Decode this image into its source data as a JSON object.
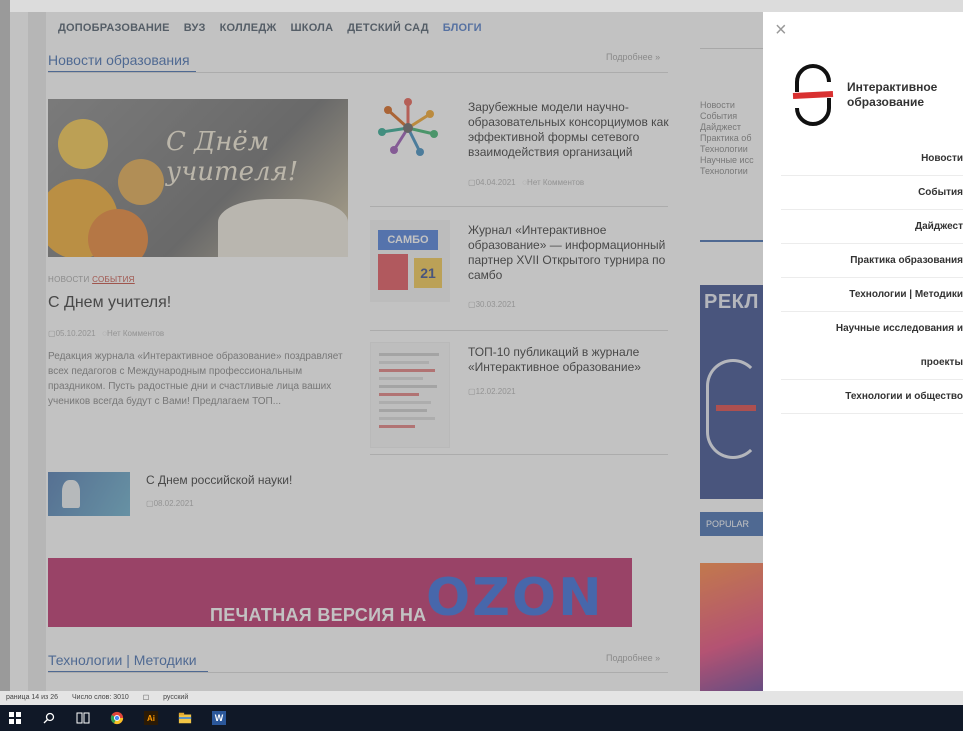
{
  "topnav": [
    "ДОПОБРАЗОВАНИЕ",
    "ВУЗ",
    "КОЛЛЕДЖ",
    "ШКОЛА",
    "ДЕТСКИЙ САД",
    "БЛОГИ"
  ],
  "section1": {
    "title": "Новости образования",
    "more": "Подробнее »"
  },
  "hero": {
    "script_text": "С Днём учителя!"
  },
  "featured": {
    "tag1": "НОВОСТИ",
    "tag2": "СОБЫТИЯ",
    "title": "С Днем учителя!",
    "date": "05.10.2021",
    "comments": "Нет Комментов",
    "excerpt": "Редакция журнала «Интерактивное образование» поздравляет всех педагогов с Международным профессиональным праздником. Пусть радостные дни и счастливые лица ваших учеников всегда будут с Вами! Предлагаем ТОП..."
  },
  "news": [
    {
      "title": "Зарубежные модели научно-образовательных консорциумов как эффективной формы сетевого взаимодействия организаций",
      "date": "04.04.2021",
      "comments": "Нет Комментов"
    },
    {
      "title": "Журнал «Интерактивное образование» — информационный партнер XVII Открытого турнира по самбо",
      "date": "30.03.2021"
    },
    {
      "title": "ТОП-10 публикаций в журнале «Интерактивное образование»",
      "date": "12.02.2021"
    },
    {
      "title": "С Днем российской науки!",
      "date": "08.02.2021"
    }
  ],
  "thumb_labels": {
    "sambo": "САМБО",
    "sambo_num": "21"
  },
  "right_list": [
    "Новости",
    "События",
    "Дайджест",
    "Практика об",
    "Технологии",
    "Научные исс",
    "Технологии"
  ],
  "ad": {
    "text": "РЕКЛ"
  },
  "popular": "POPULAR",
  "banner": {
    "text": "ПЕЧАТНАЯ ВЕРСИЯ НА",
    "brand": "OZON"
  },
  "section2": {
    "title": "Технологии | Методики",
    "more": "Подробнее »"
  },
  "panel": {
    "close": "×",
    "logo_line1": "Интерактивное",
    "logo_line2": "образование",
    "menu": [
      "Новости",
      "События",
      "Дайджест",
      "Практика образования",
      "Технологии | Методики",
      "Научные исследования и",
      "проекты",
      "Технологии и общество"
    ]
  },
  "statusbar": {
    "page": "раница 14 из 26",
    "words": "Число слов: 3010",
    "lang": "русский"
  },
  "taskbar": {
    "icons": [
      "windows-icon",
      "search-icon",
      "task-view-icon",
      "chrome-icon",
      "illustrator-icon",
      "file-explorer-icon",
      "word-icon"
    ]
  },
  "colors": {
    "accent": "#2f5ea8",
    "tag_red": "#c0392b",
    "banner": "#b5195a",
    "ozon": "#1f5ad6",
    "logo_red": "#d93030"
  }
}
